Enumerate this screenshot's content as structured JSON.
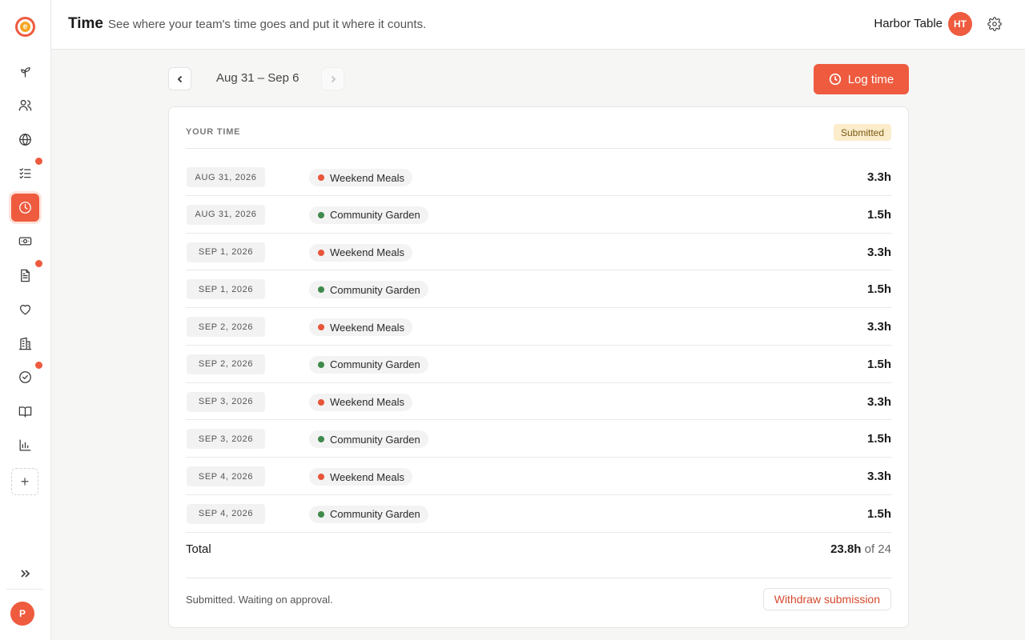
{
  "app": {
    "logo_letter": "e"
  },
  "sidebar": {
    "items": [
      {
        "name": "sidebar-item-sprout",
        "icon": "sprout-icon",
        "top": 0
      },
      {
        "name": "sidebar-item-people",
        "icon": "people-icon"
      },
      {
        "name": "sidebar-item-globe",
        "icon": "globe-icon"
      },
      {
        "name": "sidebar-item-checklist",
        "icon": "checklist-icon",
        "notify": true
      },
      {
        "name": "sidebar-item-time",
        "icon": "clock-icon",
        "active": true
      },
      {
        "name": "sidebar-item-money",
        "icon": "money-icon"
      },
      {
        "name": "sidebar-item-document",
        "icon": "document-icon",
        "notify": true
      },
      {
        "name": "sidebar-item-heart",
        "icon": "heart-icon"
      },
      {
        "name": "sidebar-item-building",
        "icon": "building-icon"
      },
      {
        "name": "sidebar-item-tasks",
        "icon": "check-circle-icon",
        "notify": true
      },
      {
        "name": "sidebar-item-book",
        "icon": "book-icon"
      },
      {
        "name": "sidebar-item-reports",
        "icon": "bar-chart-icon"
      }
    ],
    "add_label": "+",
    "user_initial": "P"
  },
  "header": {
    "title": "Time",
    "subtitle": "See where your team's time goes and put it where it counts.",
    "org_name": "Harbor Table",
    "org_initials": "HT"
  },
  "week_nav": {
    "label": "Aug 31 – Sep 6",
    "log_time_label": "Log time"
  },
  "card": {
    "section_label": "YOUR TIME",
    "status": "Submitted",
    "entries": [
      {
        "date": "Aug 31, 2026",
        "project": "Weekend Meals",
        "color": "#e8553a",
        "hours": "3.3h"
      },
      {
        "date": "Aug 31, 2026",
        "project": "Community Garden",
        "color": "#3f8a4a",
        "hours": "1.5h"
      },
      {
        "date": "Sep 1, 2026",
        "project": "Weekend Meals",
        "color": "#e8553a",
        "hours": "3.3h"
      },
      {
        "date": "Sep 1, 2026",
        "project": "Community Garden",
        "color": "#3f8a4a",
        "hours": "1.5h"
      },
      {
        "date": "Sep 2, 2026",
        "project": "Weekend Meals",
        "color": "#e8553a",
        "hours": "3.3h"
      },
      {
        "date": "Sep 2, 2026",
        "project": "Community Garden",
        "color": "#3f8a4a",
        "hours": "1.5h"
      },
      {
        "date": "Sep 3, 2026",
        "project": "Weekend Meals",
        "color": "#e8553a",
        "hours": "3.3h"
      },
      {
        "date": "Sep 3, 2026",
        "project": "Community Garden",
        "color": "#3f8a4a",
        "hours": "1.5h"
      },
      {
        "date": "Sep 4, 2026",
        "project": "Weekend Meals",
        "color": "#e8553a",
        "hours": "3.3h"
      },
      {
        "date": "Sep 4, 2026",
        "project": "Community Garden",
        "color": "#3f8a4a",
        "hours": "1.5h"
      }
    ],
    "total_label": "Total",
    "total_value": "23.8h",
    "total_of": "of 24",
    "footer_text": "Submitted. Waiting on approval.",
    "withdraw_label": "Withdraw submission"
  },
  "colors": {
    "accent": "#ee5b3f",
    "badge_bg": "#fbeccb"
  }
}
